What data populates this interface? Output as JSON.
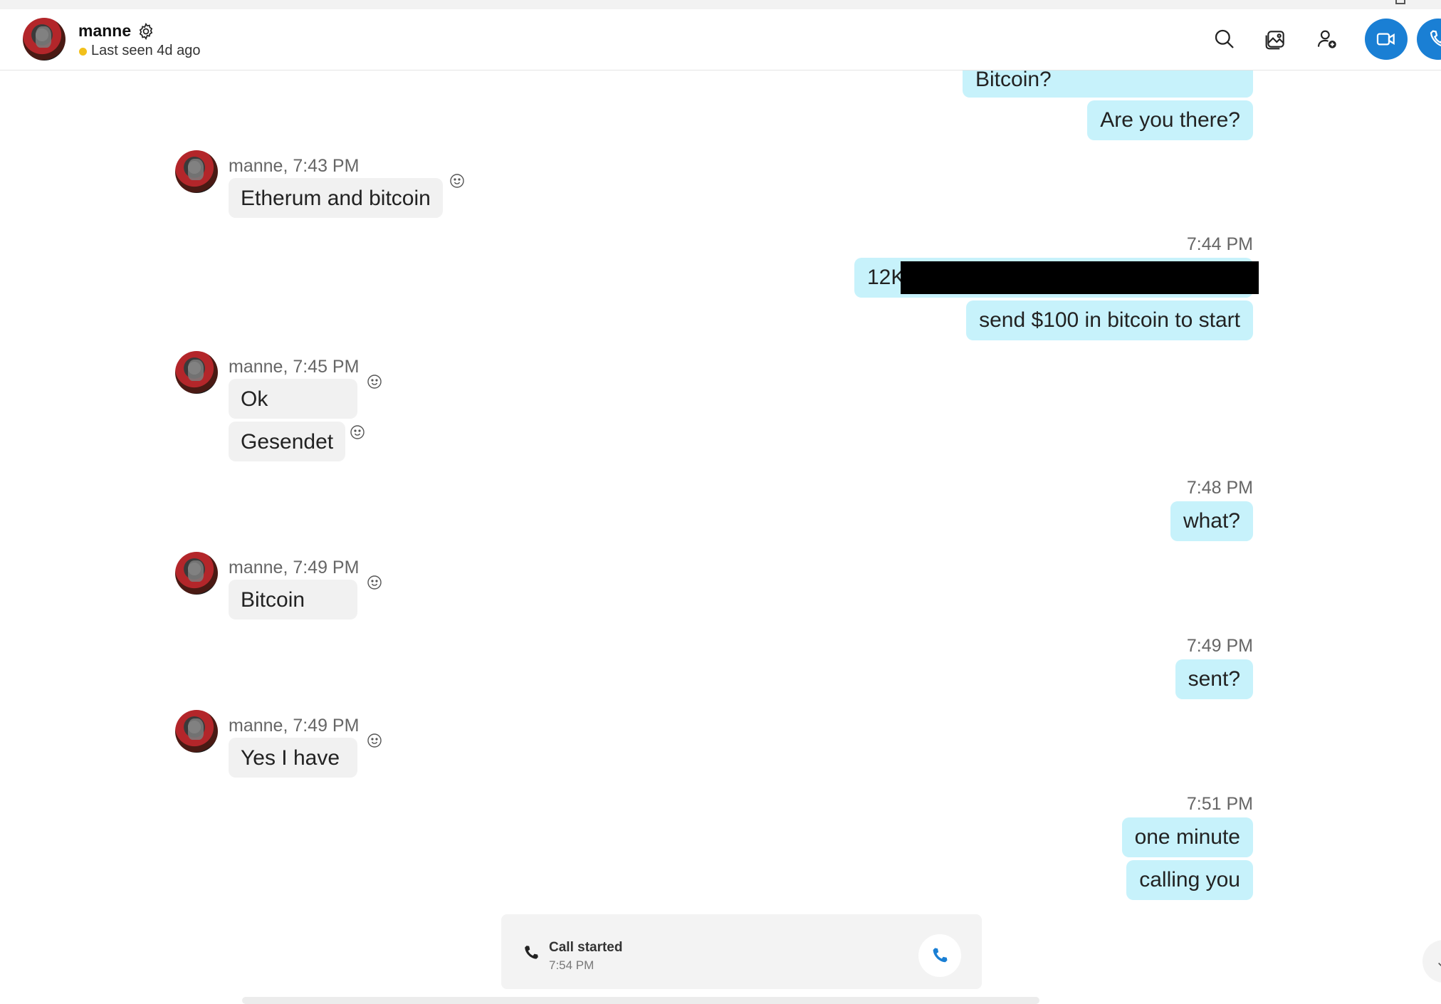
{
  "header": {
    "contact_name": "manne",
    "status": "Last seen 4d ago",
    "status_color": "#f2c01b",
    "actions": [
      "search-icon",
      "gallery-icon",
      "add-person-icon",
      "video-call-icon",
      "audio-call-icon"
    ],
    "accent": "#1a7fd4"
  },
  "messages": {
    "out_1": "Bitcoin?",
    "out_2": "Are you there?",
    "in_1_meta": "manne, 7:43 PM",
    "in_1_text": "Etherum and bitcoin",
    "out_3_time": "7:44 PM",
    "out_3_text": "12K",
    "out_4": "send $100 in bitcoin to start",
    "in_2_meta": "manne, 7:45 PM",
    "in_2_text": "Ok",
    "in_3_text": "Gesendet",
    "out_5_time": "7:48 PM",
    "out_5_text": "what?",
    "in_4_meta": "manne, 7:49 PM",
    "in_4_text": "Bitcoin",
    "out_6_time": "7:49 PM",
    "out_6_text": "sent?",
    "in_5_meta": "manne, 7:49 PM",
    "in_5_text": "Yes I have",
    "out_7_time": "7:51 PM",
    "out_7_text": "one minute",
    "out_8_text": "calling you"
  },
  "call": {
    "title": "Call started",
    "time": "7:54 PM"
  },
  "colors": {
    "outgoing_bubble": "#c7f2fb",
    "incoming_bubble": "#f1f1f1"
  }
}
